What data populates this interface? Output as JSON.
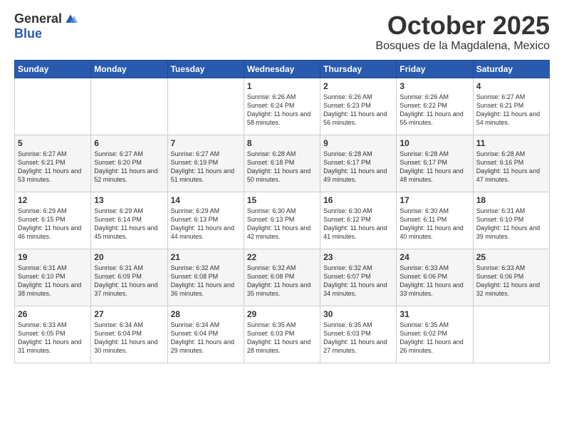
{
  "logo": {
    "general": "General",
    "blue": "Blue"
  },
  "title": "October 2025",
  "location": "Bosques de la Magdalena, Mexico",
  "days_of_week": [
    "Sunday",
    "Monday",
    "Tuesday",
    "Wednesday",
    "Thursday",
    "Friday",
    "Saturday"
  ],
  "weeks": [
    [
      {
        "day": "",
        "sunrise": "",
        "sunset": "",
        "daylight": ""
      },
      {
        "day": "",
        "sunrise": "",
        "sunset": "",
        "daylight": ""
      },
      {
        "day": "",
        "sunrise": "",
        "sunset": "",
        "daylight": ""
      },
      {
        "day": "1",
        "sunrise": "Sunrise: 6:26 AM",
        "sunset": "Sunset: 6:24 PM",
        "daylight": "Daylight: 11 hours and 58 minutes."
      },
      {
        "day": "2",
        "sunrise": "Sunrise: 6:26 AM",
        "sunset": "Sunset: 6:23 PM",
        "daylight": "Daylight: 11 hours and 56 minutes."
      },
      {
        "day": "3",
        "sunrise": "Sunrise: 6:26 AM",
        "sunset": "Sunset: 6:22 PM",
        "daylight": "Daylight: 11 hours and 55 minutes."
      },
      {
        "day": "4",
        "sunrise": "Sunrise: 6:27 AM",
        "sunset": "Sunset: 6:21 PM",
        "daylight": "Daylight: 11 hours and 54 minutes."
      }
    ],
    [
      {
        "day": "5",
        "sunrise": "Sunrise: 6:27 AM",
        "sunset": "Sunset: 6:21 PM",
        "daylight": "Daylight: 11 hours and 53 minutes."
      },
      {
        "day": "6",
        "sunrise": "Sunrise: 6:27 AM",
        "sunset": "Sunset: 6:20 PM",
        "daylight": "Daylight: 11 hours and 52 minutes."
      },
      {
        "day": "7",
        "sunrise": "Sunrise: 6:27 AM",
        "sunset": "Sunset: 6:19 PM",
        "daylight": "Daylight: 11 hours and 51 minutes."
      },
      {
        "day": "8",
        "sunrise": "Sunrise: 6:28 AM",
        "sunset": "Sunset: 6:18 PM",
        "daylight": "Daylight: 11 hours and 50 minutes."
      },
      {
        "day": "9",
        "sunrise": "Sunrise: 6:28 AM",
        "sunset": "Sunset: 6:17 PM",
        "daylight": "Daylight: 11 hours and 49 minutes."
      },
      {
        "day": "10",
        "sunrise": "Sunrise: 6:28 AM",
        "sunset": "Sunset: 6:17 PM",
        "daylight": "Daylight: 11 hours and 48 minutes."
      },
      {
        "day": "11",
        "sunrise": "Sunrise: 6:28 AM",
        "sunset": "Sunset: 6:16 PM",
        "daylight": "Daylight: 11 hours and 47 minutes."
      }
    ],
    [
      {
        "day": "12",
        "sunrise": "Sunrise: 6:29 AM",
        "sunset": "Sunset: 6:15 PM",
        "daylight": "Daylight: 11 hours and 46 minutes."
      },
      {
        "day": "13",
        "sunrise": "Sunrise: 6:29 AM",
        "sunset": "Sunset: 6:14 PM",
        "daylight": "Daylight: 11 hours and 45 minutes."
      },
      {
        "day": "14",
        "sunrise": "Sunrise: 6:29 AM",
        "sunset": "Sunset: 6:13 PM",
        "daylight": "Daylight: 11 hours and 44 minutes."
      },
      {
        "day": "15",
        "sunrise": "Sunrise: 6:30 AM",
        "sunset": "Sunset: 6:13 PM",
        "daylight": "Daylight: 11 hours and 42 minutes."
      },
      {
        "day": "16",
        "sunrise": "Sunrise: 6:30 AM",
        "sunset": "Sunset: 6:12 PM",
        "daylight": "Daylight: 11 hours and 41 minutes."
      },
      {
        "day": "17",
        "sunrise": "Sunrise: 6:30 AM",
        "sunset": "Sunset: 6:11 PM",
        "daylight": "Daylight: 11 hours and 40 minutes."
      },
      {
        "day": "18",
        "sunrise": "Sunrise: 6:31 AM",
        "sunset": "Sunset: 6:10 PM",
        "daylight": "Daylight: 11 hours and 39 minutes."
      }
    ],
    [
      {
        "day": "19",
        "sunrise": "Sunrise: 6:31 AM",
        "sunset": "Sunset: 6:10 PM",
        "daylight": "Daylight: 11 hours and 38 minutes."
      },
      {
        "day": "20",
        "sunrise": "Sunrise: 6:31 AM",
        "sunset": "Sunset: 6:09 PM",
        "daylight": "Daylight: 11 hours and 37 minutes."
      },
      {
        "day": "21",
        "sunrise": "Sunrise: 6:32 AM",
        "sunset": "Sunset: 6:08 PM",
        "daylight": "Daylight: 11 hours and 36 minutes."
      },
      {
        "day": "22",
        "sunrise": "Sunrise: 6:32 AM",
        "sunset": "Sunset: 6:08 PM",
        "daylight": "Daylight: 11 hours and 35 minutes."
      },
      {
        "day": "23",
        "sunrise": "Sunrise: 6:32 AM",
        "sunset": "Sunset: 6:07 PM",
        "daylight": "Daylight: 11 hours and 34 minutes."
      },
      {
        "day": "24",
        "sunrise": "Sunrise: 6:33 AM",
        "sunset": "Sunset: 6:06 PM",
        "daylight": "Daylight: 11 hours and 33 minutes."
      },
      {
        "day": "25",
        "sunrise": "Sunrise: 6:33 AM",
        "sunset": "Sunset: 6:06 PM",
        "daylight": "Daylight: 11 hours and 32 minutes."
      }
    ],
    [
      {
        "day": "26",
        "sunrise": "Sunrise: 6:33 AM",
        "sunset": "Sunset: 6:05 PM",
        "daylight": "Daylight: 11 hours and 31 minutes."
      },
      {
        "day": "27",
        "sunrise": "Sunrise: 6:34 AM",
        "sunset": "Sunset: 6:04 PM",
        "daylight": "Daylight: 11 hours and 30 minutes."
      },
      {
        "day": "28",
        "sunrise": "Sunrise: 6:34 AM",
        "sunset": "Sunset: 6:04 PM",
        "daylight": "Daylight: 11 hours and 29 minutes."
      },
      {
        "day": "29",
        "sunrise": "Sunrise: 6:35 AM",
        "sunset": "Sunset: 6:03 PM",
        "daylight": "Daylight: 11 hours and 28 minutes."
      },
      {
        "day": "30",
        "sunrise": "Sunrise: 6:35 AM",
        "sunset": "Sunset: 6:03 PM",
        "daylight": "Daylight: 11 hours and 27 minutes."
      },
      {
        "day": "31",
        "sunrise": "Sunrise: 6:35 AM",
        "sunset": "Sunset: 6:02 PM",
        "daylight": "Daylight: 11 hours and 26 minutes."
      },
      {
        "day": "",
        "sunrise": "",
        "sunset": "",
        "daylight": ""
      }
    ]
  ]
}
